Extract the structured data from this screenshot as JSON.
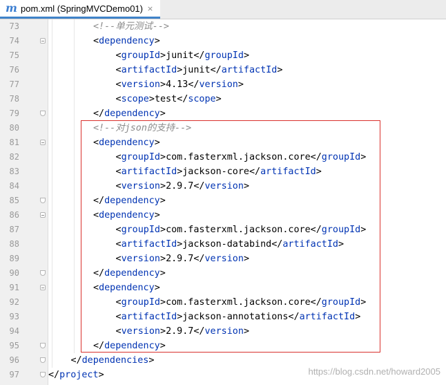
{
  "tab": {
    "icon": "m",
    "title": "pom.xml (SpringMVCDemo01)",
    "close": "×"
  },
  "lines": [
    {
      "n": "73",
      "indent": 2,
      "kind": "comment",
      "text": "<!--单元测试-->"
    },
    {
      "n": "74",
      "indent": 2,
      "kind": "open",
      "tag": "dependency"
    },
    {
      "n": "75",
      "indent": 3,
      "kind": "elem",
      "tag": "groupId",
      "value": "junit"
    },
    {
      "n": "76",
      "indent": 3,
      "kind": "elem",
      "tag": "artifactId",
      "value": "junit"
    },
    {
      "n": "77",
      "indent": 3,
      "kind": "elem",
      "tag": "version",
      "value": "4.13"
    },
    {
      "n": "78",
      "indent": 3,
      "kind": "elem",
      "tag": "scope",
      "value": "test"
    },
    {
      "n": "79",
      "indent": 2,
      "kind": "close",
      "tag": "dependency"
    },
    {
      "n": "80",
      "indent": 2,
      "kind": "comment",
      "text": "<!--对json的支持-->"
    },
    {
      "n": "81",
      "indent": 2,
      "kind": "open",
      "tag": "dependency"
    },
    {
      "n": "82",
      "indent": 3,
      "kind": "elem",
      "tag": "groupId",
      "value": "com.fasterxml.jackson.core"
    },
    {
      "n": "83",
      "indent": 3,
      "kind": "elem",
      "tag": "artifactId",
      "value": "jackson-core"
    },
    {
      "n": "84",
      "indent": 3,
      "kind": "elem",
      "tag": "version",
      "value": "2.9.7"
    },
    {
      "n": "85",
      "indent": 2,
      "kind": "close",
      "tag": "dependency"
    },
    {
      "n": "86",
      "indent": 2,
      "kind": "open",
      "tag": "dependency"
    },
    {
      "n": "87",
      "indent": 3,
      "kind": "elem",
      "tag": "groupId",
      "value": "com.fasterxml.jackson.core"
    },
    {
      "n": "88",
      "indent": 3,
      "kind": "elem",
      "tag": "artifactId",
      "value": "jackson-databind"
    },
    {
      "n": "89",
      "indent": 3,
      "kind": "elem",
      "tag": "version",
      "value": "2.9.7"
    },
    {
      "n": "90",
      "indent": 2,
      "kind": "close",
      "tag": "dependency"
    },
    {
      "n": "91",
      "indent": 2,
      "kind": "open",
      "tag": "dependency"
    },
    {
      "n": "92",
      "indent": 3,
      "kind": "elem",
      "tag": "groupId",
      "value": "com.fasterxml.jackson.core"
    },
    {
      "n": "93",
      "indent": 3,
      "kind": "elem",
      "tag": "artifactId",
      "value": "jackson-annotations"
    },
    {
      "n": "94",
      "indent": 3,
      "kind": "elem",
      "tag": "version",
      "value": "2.9.7"
    },
    {
      "n": "95",
      "indent": 2,
      "kind": "close",
      "tag": "dependency"
    },
    {
      "n": "96",
      "indent": 1,
      "kind": "close",
      "tag": "dependencies"
    },
    {
      "n": "97",
      "indent": 0,
      "kind": "close",
      "tag": "project"
    }
  ],
  "watermark": "https://blog.csdn.net/howard2005",
  "colors": {
    "tag": "#0033b3",
    "comment": "#8c8c8c",
    "highlight": "#d9302c",
    "tab_accent": "#4083c9"
  },
  "icons": {
    "tab_icon": "maven-m-icon",
    "fold_marker": "fold-marker-icon",
    "close": "close-icon"
  }
}
